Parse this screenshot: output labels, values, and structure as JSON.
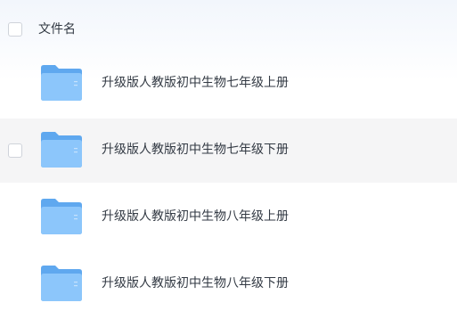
{
  "list": {
    "header": {
      "name_label": "文件名"
    },
    "items": [
      {
        "name": "升级版人教版初中生物七年级上册",
        "hovered": false
      },
      {
        "name": "升级版人教版初中生物七年级下册",
        "hovered": true
      },
      {
        "name": "升级版人教版初中生物八年级上册",
        "hovered": false
      },
      {
        "name": "升级版人教版初中生物八年级下册",
        "hovered": false
      }
    ]
  },
  "icons": {
    "item_icon": "folder-icon"
  },
  "colors": {
    "folder_front": "#8cc6fb",
    "folder_back": "#5fa8ef",
    "hover_row": "#f5f5f6",
    "text": "#333a44",
    "checkbox_border": "#cfd3da"
  }
}
